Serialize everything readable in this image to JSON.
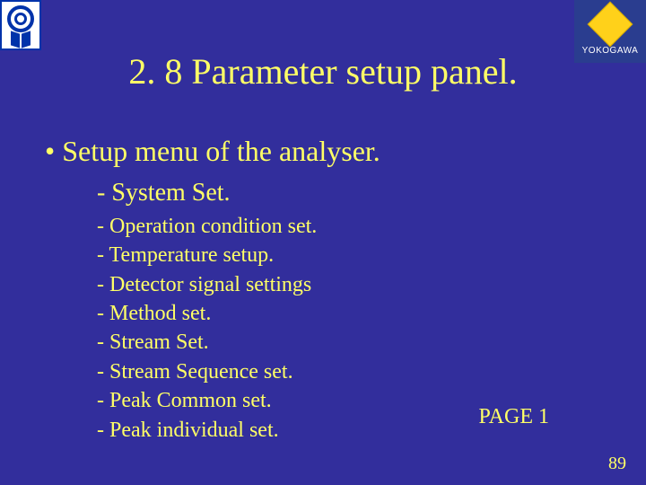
{
  "brand": {
    "name": "YOKOGAWA"
  },
  "title": "2. 8 Parameter setup panel.",
  "bullet": "• Setup menu of the analyser.",
  "sublist": {
    "first": "- System Set.",
    "items": [
      "- Operation condition set.",
      "- Temperature setup.",
      "- Detector signal settings",
      "- Method set.",
      "- Stream Set.",
      "- Stream Sequence set.",
      "- Peak Common set.",
      "- Peak individual set."
    ]
  },
  "page_label": "PAGE 1",
  "slide_number": "89"
}
